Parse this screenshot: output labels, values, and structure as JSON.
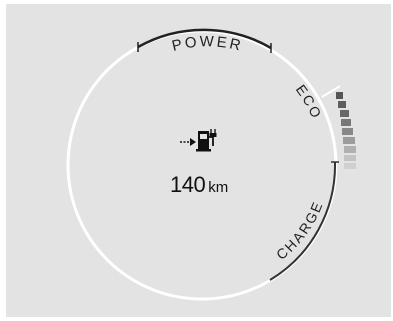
{
  "gauge": {
    "labels": {
      "power": "POWER",
      "eco": "ECO",
      "charge": "CHARGE"
    },
    "eco_level_segments_total": 9,
    "colors": {
      "background": "#e3e3e3",
      "ring": "#ffffff",
      "power_arc": "#222222",
      "charge_arc": "#333333",
      "eco_bar_dark": "#555555",
      "eco_bar_light": "#cfcfcf"
    }
  },
  "range": {
    "value": "140",
    "unit": "km"
  },
  "icons": {
    "center": "fuel-pump-plug-icon",
    "arrow": "arrow-right-icon"
  }
}
